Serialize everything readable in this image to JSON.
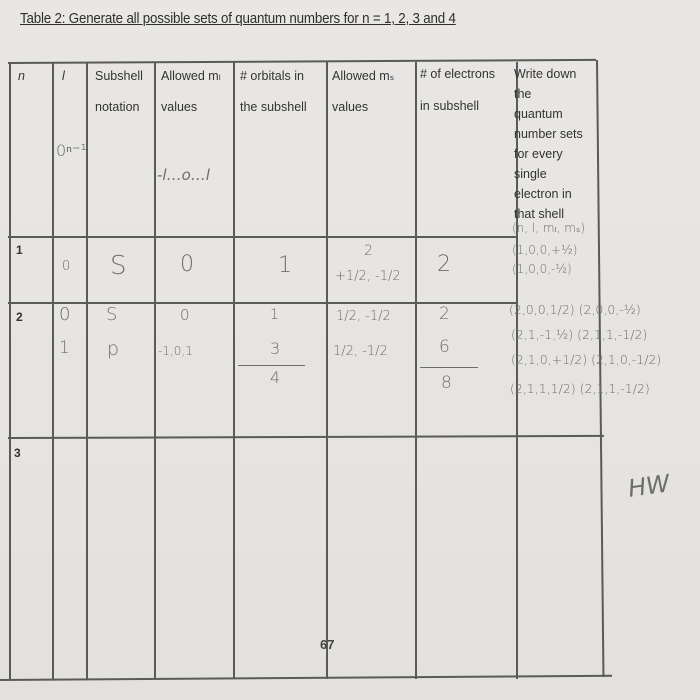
{
  "document": {
    "title": "Table 2: Generate all possible sets of quantum numbers for n = 1, 2, 3 and 4",
    "page_number": "67",
    "margin_note": "HW"
  },
  "table": {
    "headers": [
      {
        "key": "n",
        "lines": [
          "n"
        ]
      },
      {
        "key": "l",
        "lines": [
          "l"
        ]
      },
      {
        "key": "subshell",
        "lines": [
          "Subshell",
          "notation"
        ]
      },
      {
        "key": "ml",
        "lines": [
          "Allowed mₗ",
          "values"
        ]
      },
      {
        "key": "orbitals",
        "lines": [
          "# orbitals in",
          "the subshell"
        ]
      },
      {
        "key": "ms",
        "lines": [
          "Allowed mₛ",
          "values"
        ]
      },
      {
        "key": "electrons",
        "lines": [
          "# of electrons",
          "in subshell"
        ]
      },
      {
        "key": "sets",
        "lines": [
          "Write down",
          "the",
          "quantum",
          "number sets",
          "for every",
          "single",
          "electron in",
          "that shell"
        ]
      }
    ],
    "header_annotations": {
      "l_rule": "0ⁿ⁻¹",
      "ml_rule": "-l…o…l",
      "sets_format": "(n, l, mₗ, mₛ)"
    },
    "rows": [
      {
        "n": "1",
        "entries": [
          {
            "l": "0",
            "subshell": "S",
            "ml": "0",
            "orbitals": "1",
            "ms_top": "2",
            "ms": "+1/2, -1/2",
            "electrons": "2"
          }
        ],
        "sets": [
          "(1,0,0,+½)",
          "(1,0,0,-½)"
        ]
      },
      {
        "n": "2",
        "entries": [
          {
            "l": "0",
            "subshell": "S",
            "ml": "0",
            "orbitals": "1",
            "ms": "1/2, -1/2",
            "electrons": "2"
          },
          {
            "l": "1",
            "subshell": "p",
            "ml": "-1,0,1",
            "orbitals": "3",
            "ms": "1/2, -1/2",
            "electrons": "6"
          }
        ],
        "orbitals_total": "4",
        "electrons_total": "8",
        "sets": [
          "(2,0,0,1/2) (2,0,0,-½)",
          "(2,1,-1,½) (2,1,1,-1/2)",
          "(2,1,0,+1/2) (2,1,0,-1/2)",
          "(2,1,1,1/2) (2,1,1,-1/2)"
        ]
      },
      {
        "n": "3",
        "entries": [],
        "sets": []
      }
    ]
  }
}
